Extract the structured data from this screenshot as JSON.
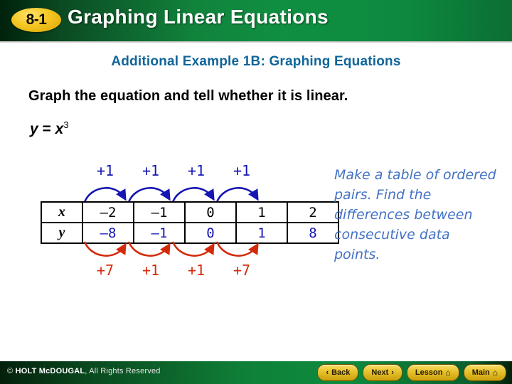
{
  "header": {
    "lesson_number": "8-1",
    "title": "Graphing Linear Equations"
  },
  "content": {
    "subtitle": "Additional Example 1B: Graphing Equations",
    "prompt": "Graph the equation and tell whether it is linear.",
    "equation_lhs": "y",
    "equation_eq": "=",
    "equation_base": "x",
    "equation_exponent": "3"
  },
  "table": {
    "row_labels": [
      "x",
      "y"
    ],
    "x_values": [
      "–2",
      "–1",
      "0",
      "1",
      "2"
    ],
    "y_values": [
      "–8",
      "–1",
      "0",
      "1",
      "8"
    ],
    "top_differences": [
      "+1",
      "+1",
      "+1",
      "+1"
    ],
    "bottom_differences": [
      "+7",
      "+1",
      "+1",
      "+7"
    ],
    "top_arrow_color": "#1515b4",
    "bottom_arrow_color": "#d42a0a"
  },
  "side_note": {
    "text": "Make a table of ordered pairs. Find the differences between consecutive data points."
  },
  "footer": {
    "copyright_prefix": "© ",
    "copyright_brand": "HOLT McDOUGAL",
    "copyright_suffix": ", All Rights Reserved",
    "buttons": [
      {
        "label": "Back",
        "icon": "chevron-left-icon",
        "glyph": "‹",
        "icon_side": "left"
      },
      {
        "label": "Next",
        "icon": "chevron-right-icon",
        "glyph": "›",
        "icon_side": "right"
      },
      {
        "label": "Lesson",
        "icon": "home-icon",
        "glyph": "⌂",
        "icon_side": "right"
      },
      {
        "label": "Main",
        "icon": "home-icon",
        "glyph": "⌂",
        "icon_side": "right"
      }
    ]
  },
  "colors": {
    "header_green": "#0f8f42",
    "badge_gold": "#f3c41f",
    "subtitle_blue": "#10659a",
    "y_value_blue": "#1515b4",
    "note_blue": "#4472c4",
    "red": "#d42a0a"
  }
}
